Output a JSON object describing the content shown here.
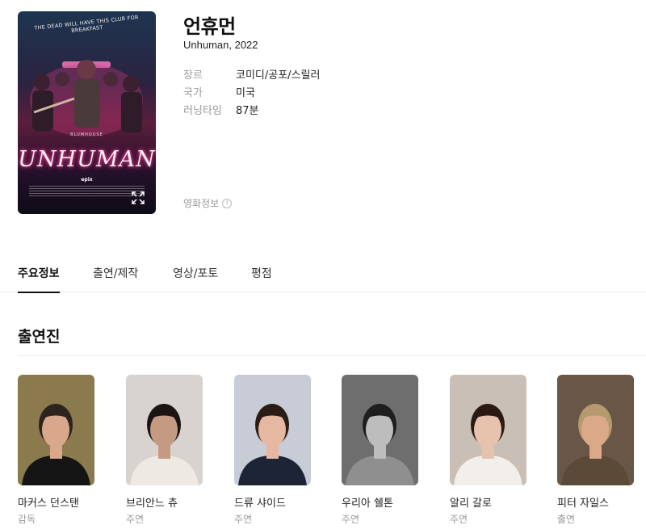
{
  "movie": {
    "title": "언휴먼",
    "subtitle": "Unhuman, 2022",
    "poster": {
      "tagline": "THE DEAD WILL HAVE THIS CLUB FOR BREAKFAST",
      "studio": "BLUMHOUSE",
      "logo_text": "UNHUMAN",
      "network": "epix",
      "expand_icon": "expand-arrows-icon"
    },
    "details": [
      {
        "label": "장르",
        "value": "코미디/공포/스릴러"
      },
      {
        "label": "국가",
        "value": "미국"
      },
      {
        "label": "러닝타임",
        "value": "87분"
      }
    ],
    "info_link": "영화정보",
    "info_icon_glyph": "!"
  },
  "tabs": [
    {
      "label": "주요정보",
      "active": true
    },
    {
      "label": "출연/제작",
      "active": false
    },
    {
      "label": "영상/포토",
      "active": false
    },
    {
      "label": "평점",
      "active": false
    }
  ],
  "cast_section": {
    "title": "출연진",
    "members": [
      {
        "name": "마커스 던스탠",
        "role": "감독",
        "bg": "#8a7a4e",
        "skin": "#d9a88c",
        "hair": "#2b2420",
        "shirt": "#151515"
      },
      {
        "name": "브리안느 츄",
        "role": "주연",
        "bg": "#d8d3cf",
        "skin": "#c49a82",
        "hair": "#1a1412",
        "shirt": "#efe9e3"
      },
      {
        "name": "드류 샤이드",
        "role": "주연",
        "bg": "#c7ccd6",
        "skin": "#e6b8a2",
        "hair": "#2a1d16",
        "shirt": "#1d2435"
      },
      {
        "name": "우리아 쉘톤",
        "role": "주연",
        "bg": "#6e6e6e",
        "skin": "#bdbdbd",
        "hair": "#1e1e1e",
        "shirt": "#8f8f8f"
      },
      {
        "name": "알리 갈로",
        "role": "주연",
        "bg": "#c9bfb6",
        "skin": "#e7c2ad",
        "hair": "#2a1a14",
        "shirt": "#f2eee9"
      },
      {
        "name": "피터 자일스",
        "role": "출연",
        "bg": "#6a5646",
        "skin": "#d9a98a",
        "hair": "#b59a6e",
        "shirt": "#5b4a38"
      }
    ]
  }
}
